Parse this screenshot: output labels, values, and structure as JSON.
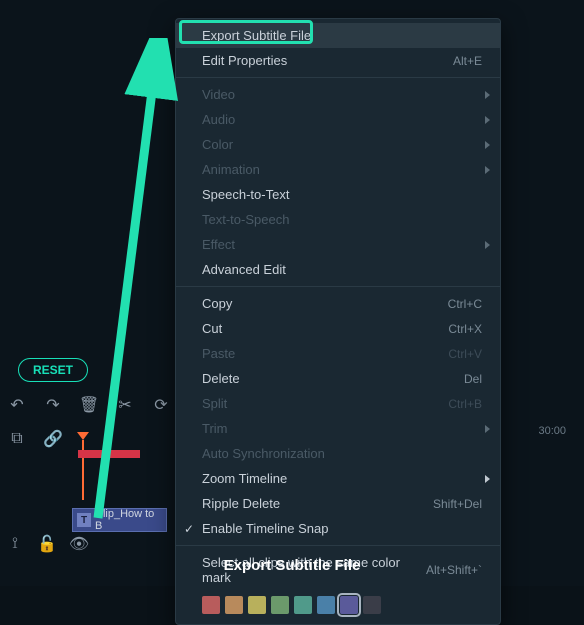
{
  "reset_label": "RESET",
  "clip_label": "Clip_How to B",
  "timeline_time": "30:00",
  "caption": "Export Subtitle File",
  "menu": {
    "export_subtitle": "Export Subtitle File",
    "edit_properties": "Edit Properties",
    "edit_properties_sc": "Alt+E",
    "video": "Video",
    "audio": "Audio",
    "color": "Color",
    "animation": "Animation",
    "speech_to_text": "Speech-to-Text",
    "text_to_speech": "Text-to-Speech",
    "effect": "Effect",
    "advanced_edit": "Advanced Edit",
    "copy": "Copy",
    "copy_sc": "Ctrl+C",
    "cut": "Cut",
    "cut_sc": "Ctrl+X",
    "paste": "Paste",
    "paste_sc": "Ctrl+V",
    "delete": "Delete",
    "delete_sc": "Del",
    "split": "Split",
    "split_sc": "Ctrl+B",
    "trim": "Trim",
    "auto_sync": "Auto Synchronization",
    "zoom_timeline": "Zoom Timeline",
    "ripple_delete": "Ripple Delete",
    "ripple_delete_sc": "Shift+Del",
    "enable_snap": "Enable Timeline Snap",
    "select_same_color": "Select all clips with the same color mark",
    "select_same_color_sc": "Alt+Shift+`"
  },
  "swatches": [
    "#b85c5c",
    "#b88a5c",
    "#b8b05c",
    "#6b9a6b",
    "#509a8a",
    "#4a80a8",
    "#5a5a9a",
    "#3a3d48"
  ],
  "swatch_selected_index": 6
}
